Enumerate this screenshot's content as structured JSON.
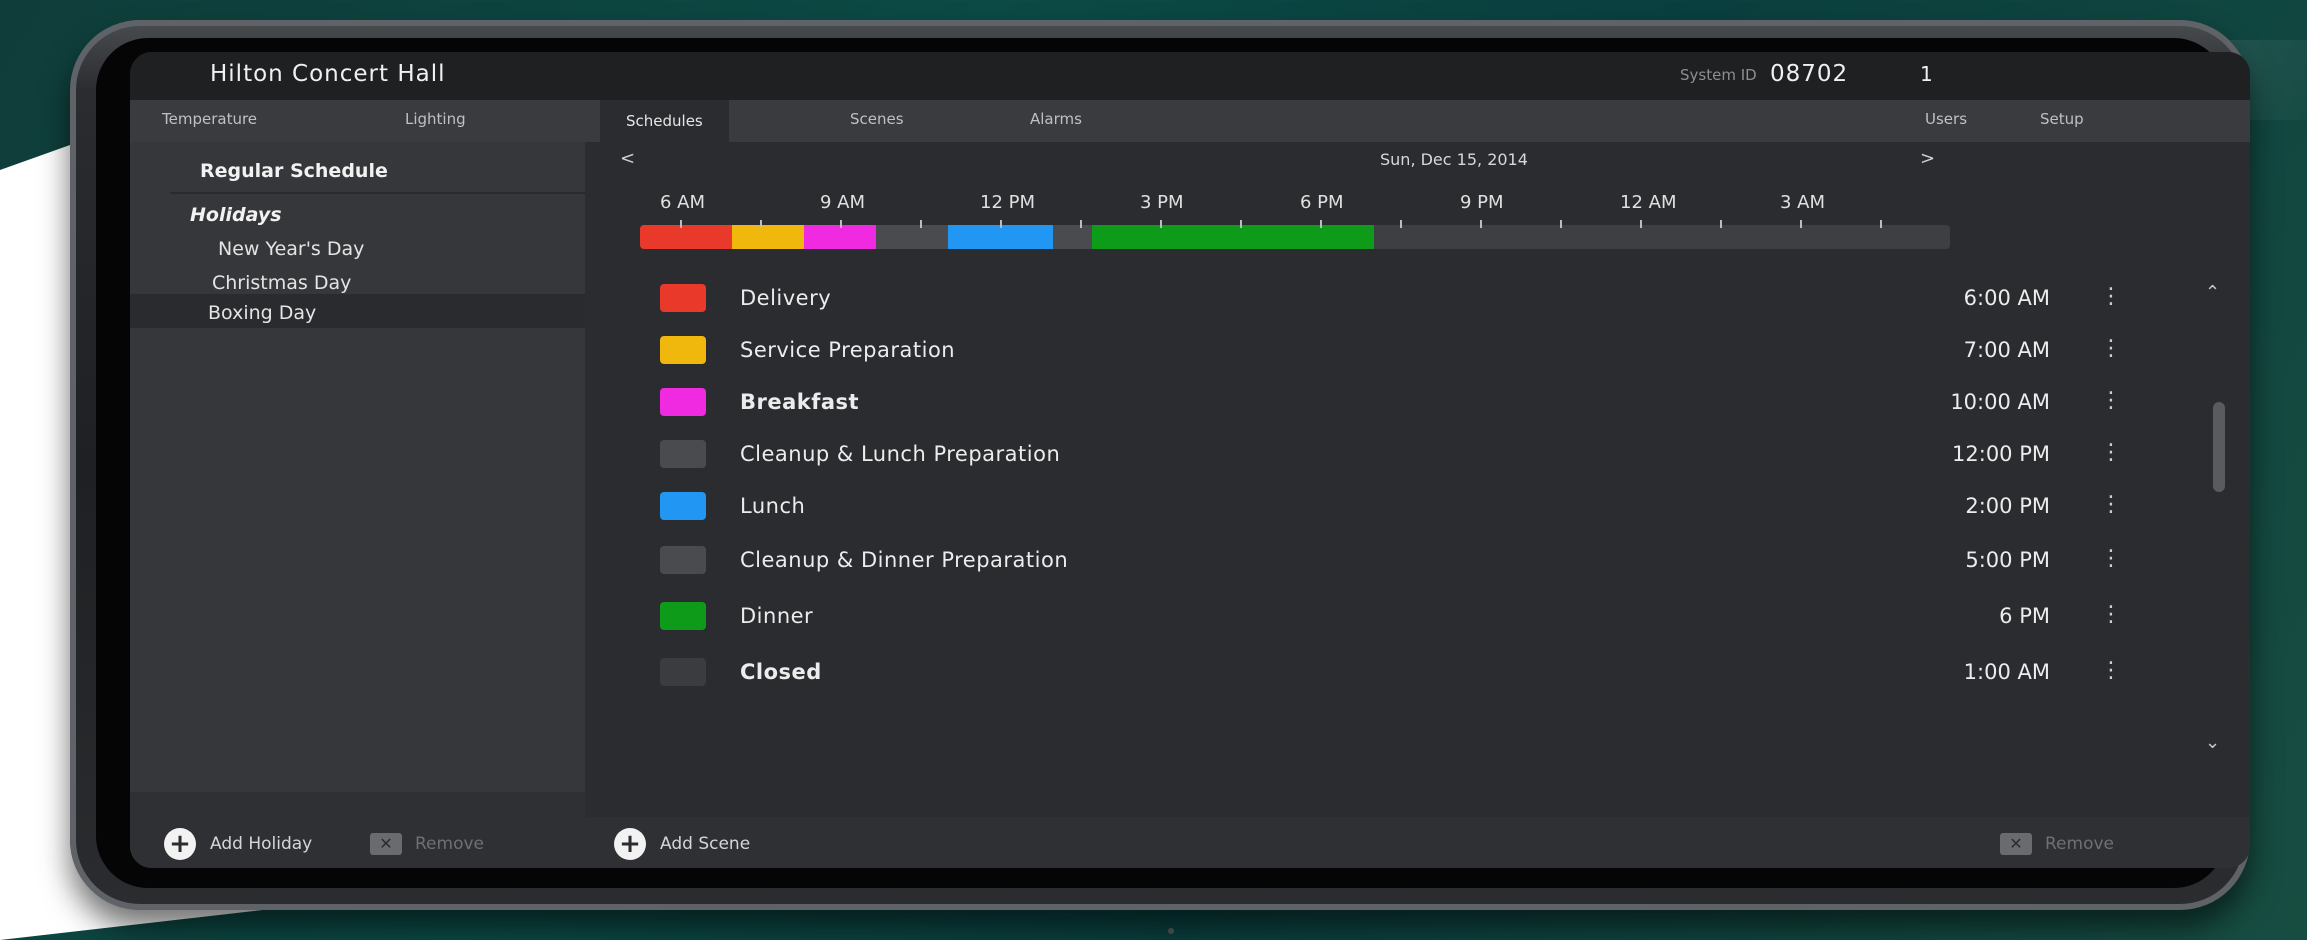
{
  "header": {
    "title": "Hilton Concert Hall",
    "sysid_label": "System ID",
    "sysid_value": "08702",
    "badge": "1"
  },
  "tabs_left": [
    {
      "label": "Temperature"
    },
    {
      "label": "Lighting"
    }
  ],
  "tabs_main": [
    {
      "label": "Schedules",
      "active": true
    },
    {
      "label": "Scenes"
    },
    {
      "label": "Alarms"
    },
    {
      "label": "Users"
    },
    {
      "label": "Setup"
    }
  ],
  "left_panel": {
    "regular_schedule": "Regular Schedule",
    "holidays_heading": "Holidays",
    "holidays": [
      {
        "label": "New Year's Day"
      },
      {
        "label": "Christmas Day"
      },
      {
        "label": "Boxing Day",
        "selected": true
      }
    ]
  },
  "datebar": {
    "prev": "<",
    "date": "Sun, Dec 15, 2014",
    "next": ">"
  },
  "timeline": {
    "labels": [
      "6 AM",
      "9 AM",
      "12 PM",
      "3 PM",
      "6 PM",
      "9 PM",
      "12 AM",
      "3 AM"
    ],
    "segments": [
      {
        "color": "#e8392b",
        "start": 0.0,
        "end": 0.07
      },
      {
        "color": "#f0b70c",
        "start": 0.07,
        "end": 0.125
      },
      {
        "color": "#ef2ae0",
        "start": 0.125,
        "end": 0.18
      },
      {
        "color": "#4a4b4e",
        "start": 0.18,
        "end": 0.235
      },
      {
        "color": "#2196f3",
        "start": 0.235,
        "end": 0.315
      },
      {
        "color": "#4a4b4e",
        "start": 0.315,
        "end": 0.345
      },
      {
        "color": "#0e9b1a",
        "start": 0.345,
        "end": 0.56
      }
    ]
  },
  "events": [
    {
      "name": "Delivery",
      "time": "6:00 AM",
      "color": "#e8392b"
    },
    {
      "name": "Service Preparation",
      "time": "7:00 AM",
      "color": "#f0b70c"
    },
    {
      "name": "Breakfast",
      "time": "10:00 AM",
      "color": "#ef2ae0"
    },
    {
      "name": "Cleanup & Lunch Preparation",
      "time": "12:00 PM",
      "color": "#4a4b4e"
    },
    {
      "name": "Lunch",
      "time": "2:00 PM",
      "color": "#2196f3"
    },
    {
      "name": "Cleanup & Dinner Preparation",
      "time": "5:00 PM",
      "color": "#4a4b4e"
    },
    {
      "name": "Dinner",
      "time": "6 PM",
      "color": "#0e9b1a"
    },
    {
      "name": "Closed",
      "time": "1:00 AM",
      "color": "#3b3c3f"
    }
  ],
  "bottom": {
    "add_holiday": "Add Holiday",
    "remove_left": "Remove",
    "add_scene": "Add Scene",
    "remove_right": "Remove"
  }
}
